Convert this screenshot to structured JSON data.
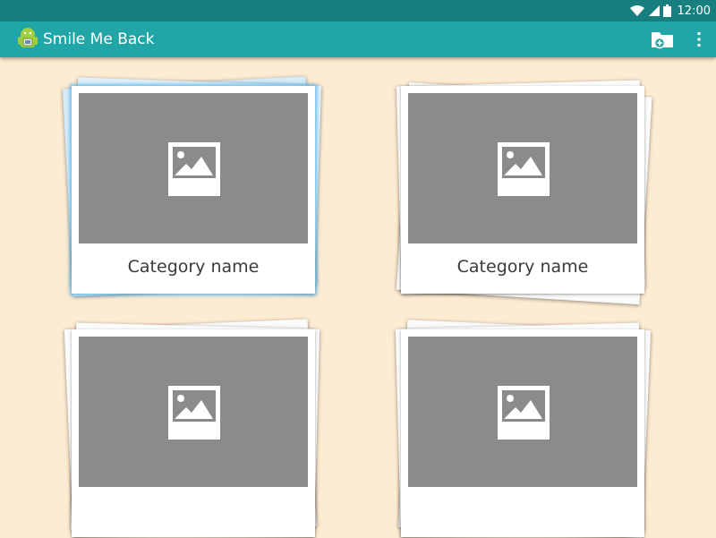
{
  "status_bar": {
    "time": "12:00",
    "icons": [
      "wifi-icon",
      "cell-signal-icon",
      "battery-icon"
    ]
  },
  "app_bar": {
    "title": "Smile Me Back",
    "logo": "android-app-logo",
    "actions": [
      "folder-add-icon",
      "overflow-menu-icon"
    ]
  },
  "categories": [
    {
      "name": "Category name",
      "image": "image-placeholder-icon",
      "selected": true
    },
    {
      "name": "Category name",
      "image": "image-placeholder-icon",
      "selected": false
    },
    {
      "name": "",
      "image": "image-placeholder-icon",
      "selected": false
    },
    {
      "name": "",
      "image": "image-placeholder-icon",
      "selected": false
    }
  ],
  "colors": {
    "status_bar": "#17807e",
    "app_bar": "#20a6a6",
    "background": "#fdebd2",
    "thumbnail": "#8b8b8b",
    "selection_glow": "#40aae6"
  }
}
